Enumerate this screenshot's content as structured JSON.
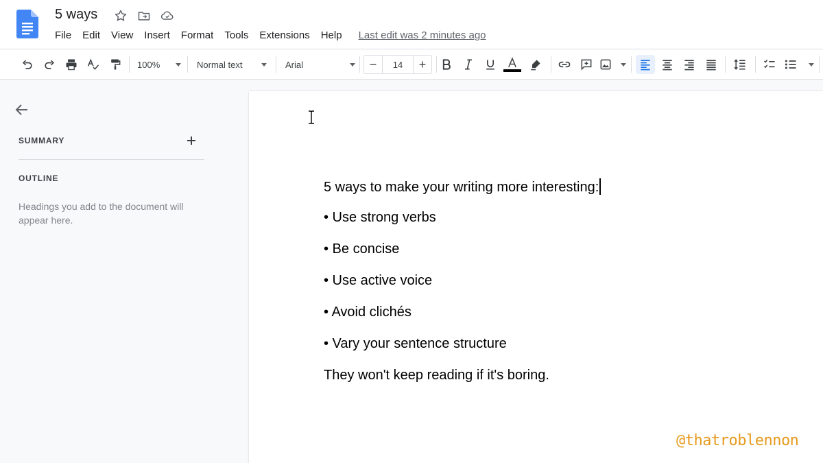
{
  "app": {
    "doc_title": "5 ways",
    "last_edit": "Last edit was 2 minutes ago",
    "menu": [
      "File",
      "Edit",
      "View",
      "Insert",
      "Format",
      "Tools",
      "Extensions",
      "Help"
    ]
  },
  "toolbar": {
    "zoom": "100%",
    "style": "Normal text",
    "font": "Arial",
    "font_size": "14",
    "minus": "−",
    "plus": "+",
    "text_color": "#000000"
  },
  "sidebar": {
    "summary_heading": "SUMMARY",
    "outline_heading": "OUTLINE",
    "outline_hint": "Headings you add to the document will appear here."
  },
  "document": {
    "lines": [
      "5 ways to make your writing more interesting:",
      "• Use strong verbs",
      "• Be concise",
      "• Use active voice",
      "• Avoid clichés",
      "• Vary your sentence structure",
      "They won't keep reading if it's boring."
    ]
  },
  "watermark": "@thatroblennon",
  "colors": {
    "docs_blue": "#4285f4",
    "watermark": "#e69a1e",
    "active_align": "#e8f0fe"
  }
}
